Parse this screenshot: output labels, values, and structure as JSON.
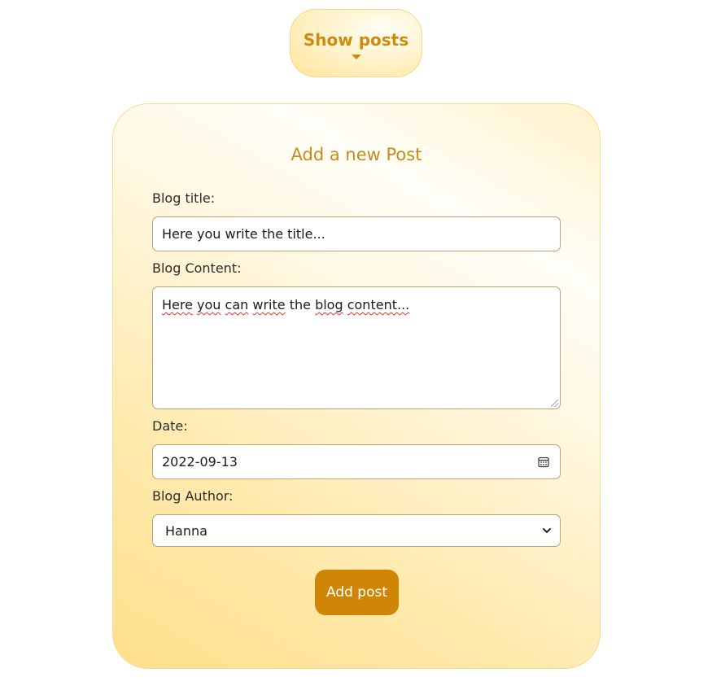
{
  "header": {
    "toggle_label": "Show posts",
    "toggle_icon": "caret-down-icon"
  },
  "form": {
    "title": "Add a new Post",
    "blog_title": {
      "label": "Blog title:",
      "value": "Here you write the title..."
    },
    "blog_content": {
      "label": "Blog Content:",
      "words": [
        "Here",
        "you",
        "can",
        "write",
        "the",
        "blog",
        "content..."
      ],
      "misspelled_words": [
        "Here",
        "you",
        "can",
        "write",
        "blog",
        "content..."
      ]
    },
    "date": {
      "label": "Date:",
      "value": "2022-09-13",
      "icon": "calendar-icon"
    },
    "author": {
      "label": "Blog Author:",
      "selected": "Hanna",
      "icon": "chevron-down-icon"
    },
    "submit_label": "Add post"
  },
  "colors": {
    "accent": "#cf8505",
    "title_text": "#c98a1b",
    "card_gradient_start": "#ffe08c",
    "card_gradient_end": "#fffdf7",
    "field_border": "#b9a17c"
  }
}
